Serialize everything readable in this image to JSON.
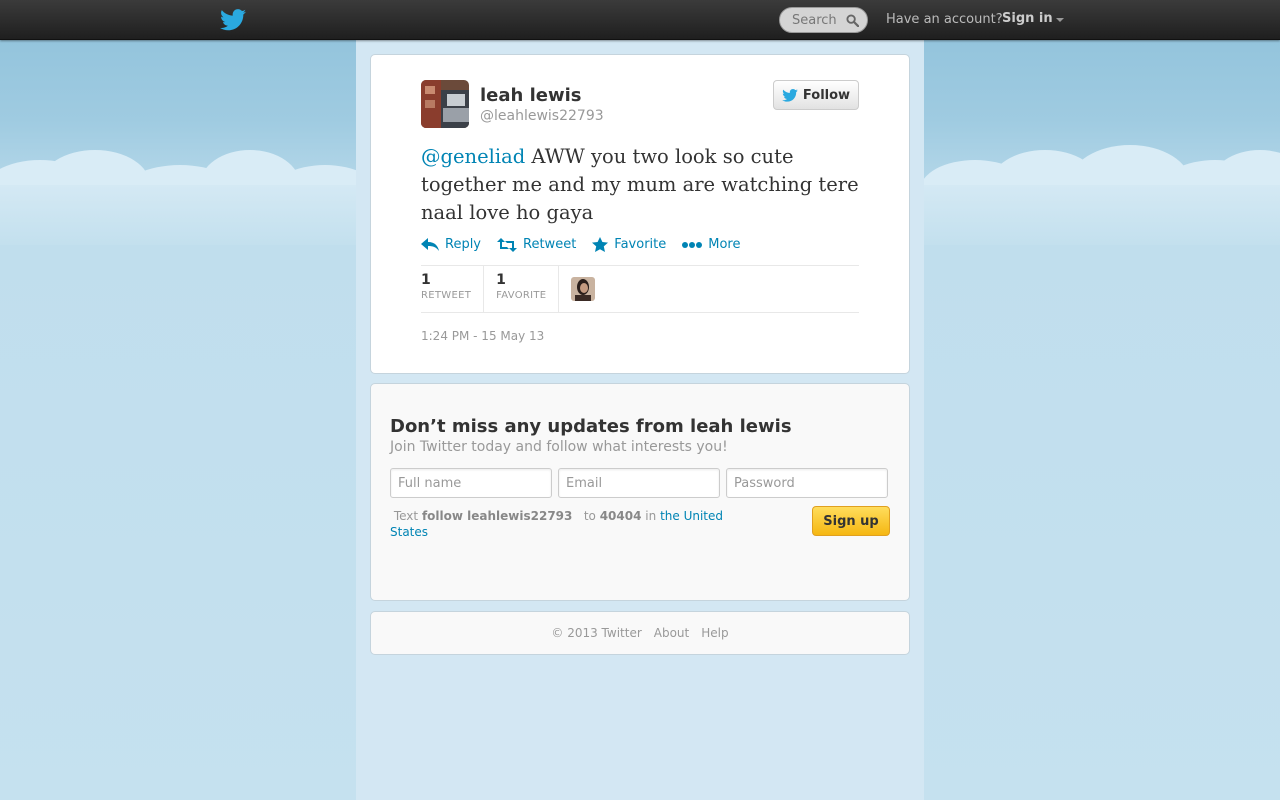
{
  "topbar": {
    "search_placeholder": "Search",
    "have_account": "Have an account?",
    "sign_in": "Sign in"
  },
  "tweet": {
    "name": "leah lewis",
    "handle": "@leahlewis22793",
    "follow_label": "Follow",
    "mention": "@geneliad",
    "text": " AWW you two look so cute together me and my mum are watching tere naal love ho gaya",
    "actions": {
      "reply": "Reply",
      "retweet": "Retweet",
      "favorite": "Favorite",
      "more": "More"
    },
    "stats": {
      "retweets": "1",
      "retweets_label": "RETWEET",
      "favorites": "1",
      "favorites_label": "FAVORITE"
    },
    "timestamp": "1:24 PM - 15 May 13"
  },
  "signup": {
    "title": "Don’t miss any updates from leah lewis",
    "subtitle": "Join Twitter today and follow what interests you!",
    "full_name_placeholder": "Full name",
    "email_placeholder": "Email",
    "password_placeholder": "Password",
    "sms_text": "Text",
    "sms_command": "follow leahlewis22793",
    "sms_to": "to",
    "sms_number": "40404",
    "sms_in": "in",
    "sms_country": "the United States",
    "button": "Sign up"
  },
  "footer": {
    "copyright": "© 2013 Twitter",
    "about": "About",
    "help": "Help"
  },
  "colors": {
    "link": "#0084b4",
    "background": "#c0deed",
    "signup_button": "#f5b712"
  }
}
